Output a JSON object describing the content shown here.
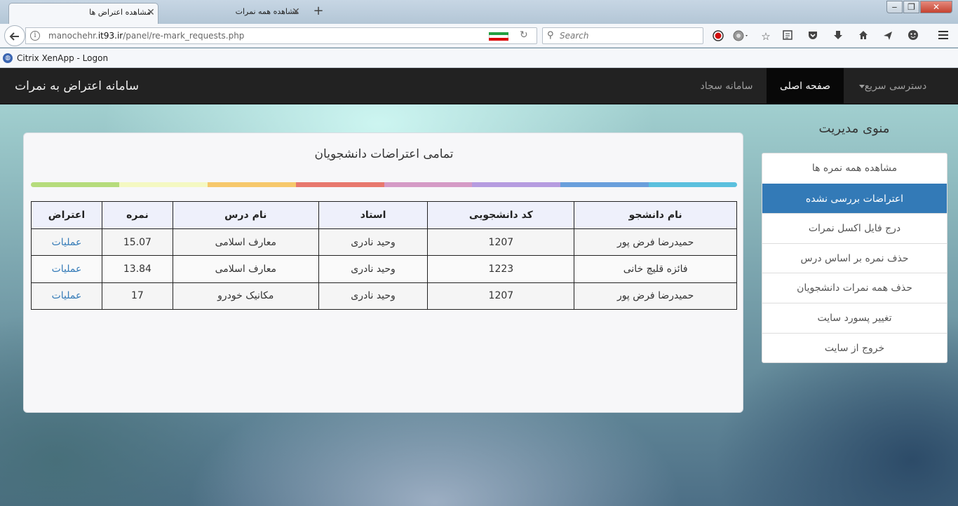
{
  "browser": {
    "tabs": [
      {
        "label": "مشاهده اعتراض ها",
        "active": true
      },
      {
        "label": "مشاهده همه نمرات",
        "active": false
      }
    ],
    "new_tab_label": "+",
    "window_buttons": {
      "minimize": "‒",
      "maximize": "❐",
      "close": "✕"
    },
    "url": {
      "prefix": "manochehr.",
      "host": "it93.ir",
      "path": "/panel/re-mark_requests.php"
    },
    "search_placeholder": "Search",
    "bookmarks": [
      {
        "label": "Citrix XenApp - Logon",
        "icon": "citrix-icon"
      }
    ],
    "toolbar_icons": [
      "record-icon",
      "addon-icon",
      "star-icon",
      "reading-list-icon",
      "pocket-icon",
      "download-icon",
      "home-icon",
      "send-icon",
      "emoji-icon",
      "menu-icon"
    ]
  },
  "site": {
    "brand": "سامانه اعتراض به نمرات",
    "nav": {
      "quick_access": "دسترسی سریع",
      "home": "صفحه اصلی",
      "sajjad": "سامانه سجاد"
    }
  },
  "sidebar": {
    "title": "منوی مدیریت",
    "items": [
      {
        "label": "مشاهده همه نمره ها",
        "active": false
      },
      {
        "label": "اعتراضات بررسی نشده",
        "active": true
      },
      {
        "label": "درج فایل اکسل نمرات",
        "active": false
      },
      {
        "label": "حذف نمره بر اساس درس",
        "active": false
      },
      {
        "label": "حذف همه نمرات دانشجویان",
        "active": false
      },
      {
        "label": "تغییر پسورد سایت",
        "active": false
      },
      {
        "label": "خروج از سایت",
        "active": false
      }
    ]
  },
  "main": {
    "title": "تمامی اعتراضات دانشجویان",
    "color_bar": [
      "#5bc0de",
      "#6a9fdc",
      "#b69ce0",
      "#d59bc6",
      "#e8786e",
      "#f6c86c",
      "#f4f8c2",
      "#b6dc7c"
    ],
    "table": {
      "headers": [
        "نام دانشجو",
        "کد دانشجویی",
        "استاد",
        "نام درس",
        "نمره",
        "اعتراض"
      ],
      "rows": [
        [
          "حمیدرضا فرض پور",
          "1207",
          "وحید نادری",
          "معارف اسلامی",
          "15.07",
          "عملیات"
        ],
        [
          "فائزه قلیچ خانی",
          "1223",
          "وحید نادری",
          "معارف اسلامی",
          "13.84",
          "عملیات"
        ],
        [
          "حمیدرضا فرض پور",
          "1207",
          "وحید نادری",
          "مکانیک خودرو",
          "17",
          "عملیات"
        ]
      ]
    }
  }
}
